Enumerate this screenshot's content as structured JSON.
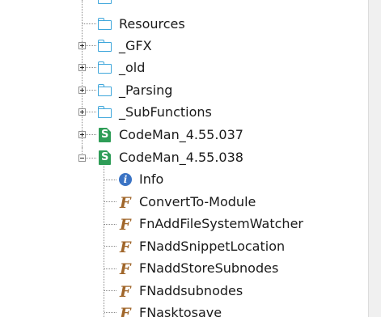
{
  "tree": {
    "items": [
      {
        "label": "Resources",
        "icon": "folder-icon"
      },
      {
        "label": "_GFX",
        "icon": "folder-icon",
        "expander": "plus"
      },
      {
        "label": "_old",
        "icon": "folder-icon",
        "expander": "plus"
      },
      {
        "label": "_Parsing",
        "icon": "folder-icon",
        "expander": "plus"
      },
      {
        "label": "_SubFunctions",
        "icon": "folder-icon",
        "expander": "plus"
      },
      {
        "label": "CodeMan_4.55.037",
        "icon": "script-icon",
        "icon_letter": "S",
        "expander": "plus"
      },
      {
        "label": "CodeMan_4.55.038",
        "icon": "script-icon",
        "icon_letter": "S",
        "expander": "minus"
      },
      {
        "label": "Info",
        "icon": "info-icon",
        "icon_letter": "i"
      },
      {
        "label": "ConvertTo-Module",
        "icon": "function-icon",
        "icon_letter": "F"
      },
      {
        "label": "FnAddFileSystemWatcher",
        "icon": "function-icon",
        "icon_letter": "F"
      },
      {
        "label": "FNaddSnippetLocation",
        "icon": "function-icon",
        "icon_letter": "F"
      },
      {
        "label": "FNaddStoreSubnodes",
        "icon": "function-icon",
        "icon_letter": "F"
      },
      {
        "label": "FNaddsubnodes",
        "icon": "function-icon",
        "icon_letter": "F"
      },
      {
        "label": "FNasktosave",
        "icon": "function-icon",
        "icon_letter": "F"
      }
    ]
  },
  "colors": {
    "folder": "#3ea6db",
    "script": "#2e9d57",
    "info": "#3a73c4",
    "function": "#a0662a"
  }
}
